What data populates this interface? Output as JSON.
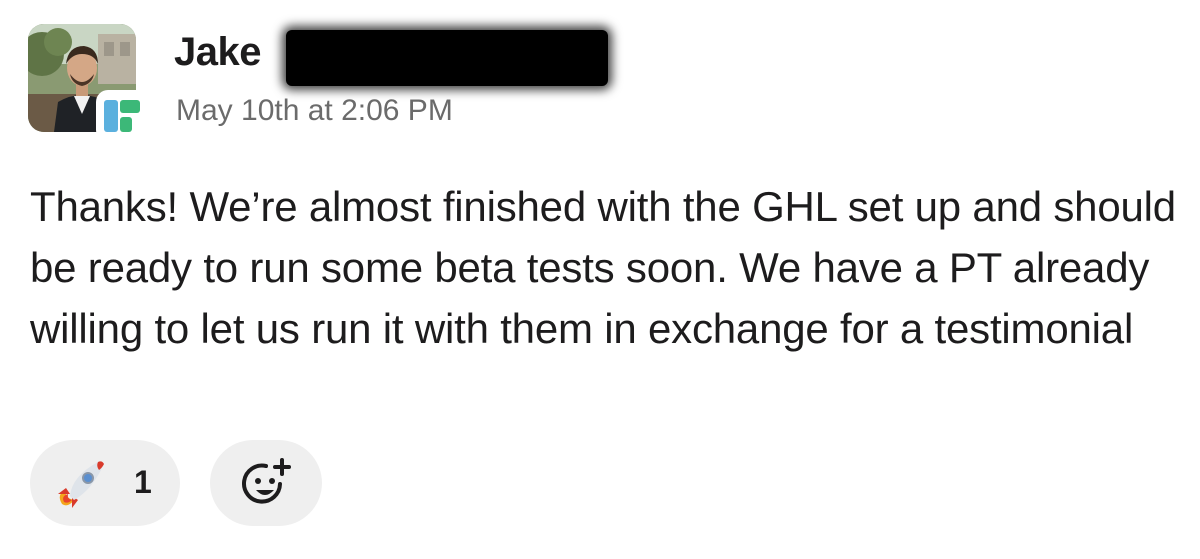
{
  "message": {
    "sender": "Jake",
    "timestamp": "May 10th at 2:06 PM",
    "body": "Thanks! We’re almost finished with the GHL set up and should be ready to run some beta tests soon. We have a PT already willing to let us run it with them in exchange for a testimonial",
    "avatar_icon": "profile-photo",
    "app_badge_icon": "app-logo-icon"
  },
  "reactions": [
    {
      "emoji": "rocket",
      "count": "1"
    }
  ],
  "add_reaction_icon": "add-reaction-icon"
}
